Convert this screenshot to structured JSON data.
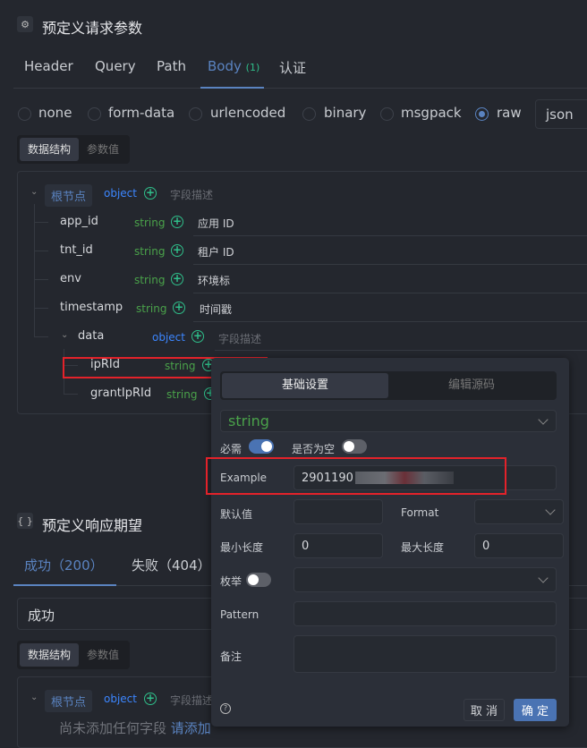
{
  "request": {
    "title": "预定义请求参数",
    "tabs": [
      {
        "label": "Header"
      },
      {
        "label": "Query"
      },
      {
        "label": "Path"
      },
      {
        "label": "Body",
        "count": "(1)"
      },
      {
        "label": "认证"
      }
    ],
    "body_types": [
      "none",
      "form-data",
      "urlencoded",
      "binary",
      "msgpack",
      "raw"
    ],
    "selected_body_type": "raw",
    "raw_format": "json",
    "view_tabs": [
      "数据结构",
      "参数值"
    ],
    "tree": {
      "root": {
        "label": "根节点",
        "type": "object",
        "desc_placeholder": "字段描述"
      },
      "fields": [
        {
          "name": "app_id",
          "type": "string",
          "desc": "应用 ID"
        },
        {
          "name": "tnt_id",
          "type": "string",
          "desc": "租户 ID"
        },
        {
          "name": "env",
          "type": "string",
          "desc": "环境标"
        },
        {
          "name": "timestamp",
          "type": "string",
          "desc": "时间戳"
        },
        {
          "name": "data",
          "type": "object",
          "desc_placeholder": "字段描述"
        },
        {
          "name": "ipRId",
          "type": "string"
        },
        {
          "name": "grantIpRId",
          "type": "string"
        }
      ]
    }
  },
  "popup": {
    "tabs": [
      "基础设置",
      "编辑源码"
    ],
    "type_value": "string",
    "required_label": "必需",
    "required": true,
    "nullable_label": "是否为空",
    "nullable": false,
    "example_label": "Example",
    "example_value": "2901190",
    "default_label": "默认值",
    "format_label": "Format",
    "min_label": "最小长度",
    "min_value": "0",
    "max_label": "最大长度",
    "max_value": "0",
    "enum_label": "枚举",
    "enum": false,
    "pattern_label": "Pattern",
    "note_label": "备注",
    "help_icon": "question-circle",
    "cancel": "取 消",
    "ok": "确 定"
  },
  "response": {
    "title": "预定义响应期望",
    "tabs": [
      "成功（200）",
      "失败（404）"
    ],
    "name_value": "成功",
    "view_tabs": [
      "数据结构",
      "参数值"
    ],
    "root": {
      "label": "根节点",
      "type": "object",
      "desc_placeholder": "字段描述"
    },
    "empty_text": "尚未添加任何字段",
    "add_link": "请添加"
  },
  "colors": {
    "accent": "#5a83c0",
    "string": "#4aa24a",
    "object": "#3c86ff",
    "plus": "#2fbf8a",
    "highlight": "#e3222a"
  }
}
